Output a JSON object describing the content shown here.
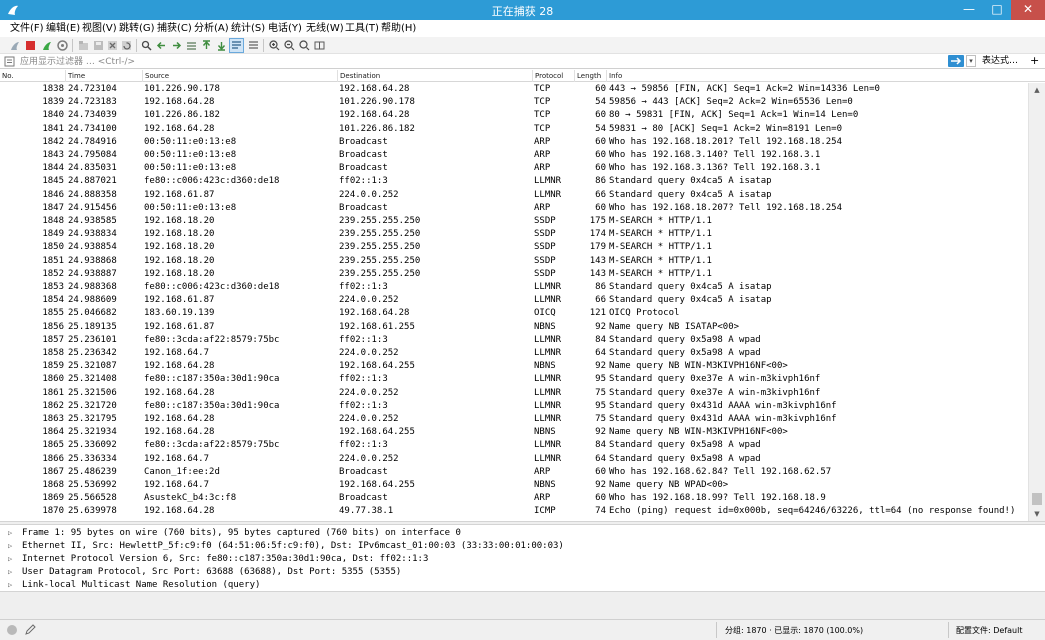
{
  "window": {
    "title": "正在捕获 28",
    "minimize": "—",
    "maximize": "□",
    "close": "✕"
  },
  "menu": [
    "文件(F)",
    "编辑(E)",
    "视图(V)",
    "跳转(G)",
    "捕获(C)",
    "分析(A)",
    "统计(S)",
    "电话(Y)",
    "无线(W)",
    "工具(T)",
    "帮助(H)"
  ],
  "filter": {
    "placeholder": "应用显示过滤器 … <Ctrl-/>",
    "dropdown_glyph": "▾",
    "expression_label": "表达式…",
    "add_label": "+"
  },
  "columns": [
    "No.",
    "Time",
    "Source",
    "Destination",
    "Protocol",
    "Length",
    "Info"
  ],
  "packets": [
    {
      "no": "1838",
      "time": "24.723104",
      "src": "101.226.90.178",
      "dst": "192.168.64.28",
      "proto": "TCP",
      "len": "60",
      "info": "443 → 59856 [FIN, ACK] Seq=1 Ack=2 Win=14336 Len=0"
    },
    {
      "no": "1839",
      "time": "24.723183",
      "src": "192.168.64.28",
      "dst": "101.226.90.178",
      "proto": "TCP",
      "len": "54",
      "info": "59856 → 443 [ACK] Seq=2 Ack=2 Win=65536 Len=0"
    },
    {
      "no": "1840",
      "time": "24.734039",
      "src": "101.226.86.182",
      "dst": "192.168.64.28",
      "proto": "TCP",
      "len": "60",
      "info": "80 → 59831 [FIN, ACK] Seq=1 Ack=1 Win=14 Len=0"
    },
    {
      "no": "1841",
      "time": "24.734100",
      "src": "192.168.64.28",
      "dst": "101.226.86.182",
      "proto": "TCP",
      "len": "54",
      "info": "59831 → 80 [ACK] Seq=1 Ack=2 Win=8191 Len=0"
    },
    {
      "no": "1842",
      "time": "24.784916",
      "src": "00:50:11:e0:13:e8",
      "dst": "Broadcast",
      "proto": "ARP",
      "len": "60",
      "info": "Who has 192.168.18.201? Tell 192.168.18.254"
    },
    {
      "no": "1843",
      "time": "24.795084",
      "src": "00:50:11:e0:13:e8",
      "dst": "Broadcast",
      "proto": "ARP",
      "len": "60",
      "info": "Who has 192.168.3.140? Tell 192.168.3.1"
    },
    {
      "no": "1844",
      "time": "24.835031",
      "src": "00:50:11:e0:13:e8",
      "dst": "Broadcast",
      "proto": "ARP",
      "len": "60",
      "info": "Who has 192.168.3.136? Tell 192.168.3.1"
    },
    {
      "no": "1845",
      "time": "24.887021",
      "src": "fe80::c006:423c:d360:de18",
      "dst": "ff02::1:3",
      "proto": "LLMNR",
      "len": "86",
      "info": "Standard query 0x4ca5 A isatap"
    },
    {
      "no": "1846",
      "time": "24.888358",
      "src": "192.168.61.87",
      "dst": "224.0.0.252",
      "proto": "LLMNR",
      "len": "66",
      "info": "Standard query 0x4ca5 A isatap"
    },
    {
      "no": "1847",
      "time": "24.915456",
      "src": "00:50:11:e0:13:e8",
      "dst": "Broadcast",
      "proto": "ARP",
      "len": "60",
      "info": "Who has 192.168.18.207? Tell 192.168.18.254"
    },
    {
      "no": "1848",
      "time": "24.938585",
      "src": "192.168.18.20",
      "dst": "239.255.255.250",
      "proto": "SSDP",
      "len": "175",
      "info": "M-SEARCH * HTTP/1.1"
    },
    {
      "no": "1849",
      "time": "24.938834",
      "src": "192.168.18.20",
      "dst": "239.255.255.250",
      "proto": "SSDP",
      "len": "174",
      "info": "M-SEARCH * HTTP/1.1"
    },
    {
      "no": "1850",
      "time": "24.938854",
      "src": "192.168.18.20",
      "dst": "239.255.255.250",
      "proto": "SSDP",
      "len": "179",
      "info": "M-SEARCH * HTTP/1.1"
    },
    {
      "no": "1851",
      "time": "24.938868",
      "src": "192.168.18.20",
      "dst": "239.255.255.250",
      "proto": "SSDP",
      "len": "143",
      "info": "M-SEARCH * HTTP/1.1"
    },
    {
      "no": "1852",
      "time": "24.938887",
      "src": "192.168.18.20",
      "dst": "239.255.255.250",
      "proto": "SSDP",
      "len": "143",
      "info": "M-SEARCH * HTTP/1.1"
    },
    {
      "no": "1853",
      "time": "24.988368",
      "src": "fe80::c006:423c:d360:de18",
      "dst": "ff02::1:3",
      "proto": "LLMNR",
      "len": "86",
      "info": "Standard query 0x4ca5 A isatap"
    },
    {
      "no": "1854",
      "time": "24.988609",
      "src": "192.168.61.87",
      "dst": "224.0.0.252",
      "proto": "LLMNR",
      "len": "66",
      "info": "Standard query 0x4ca5 A isatap"
    },
    {
      "no": "1855",
      "time": "25.046682",
      "src": "183.60.19.139",
      "dst": "192.168.64.28",
      "proto": "OICQ",
      "len": "121",
      "info": "OICQ Protocol"
    },
    {
      "no": "1856",
      "time": "25.189135",
      "src": "192.168.61.87",
      "dst": "192.168.61.255",
      "proto": "NBNS",
      "len": "92",
      "info": "Name query NB ISATAP<00>"
    },
    {
      "no": "1857",
      "time": "25.236101",
      "src": "fe80::3cda:af22:8579:75bc",
      "dst": "ff02::1:3",
      "proto": "LLMNR",
      "len": "84",
      "info": "Standard query 0x5a98 A wpad"
    },
    {
      "no": "1858",
      "time": "25.236342",
      "src": "192.168.64.7",
      "dst": "224.0.0.252",
      "proto": "LLMNR",
      "len": "64",
      "info": "Standard query 0x5a98 A wpad"
    },
    {
      "no": "1859",
      "time": "25.321087",
      "src": "192.168.64.28",
      "dst": "192.168.64.255",
      "proto": "NBNS",
      "len": "92",
      "info": "Name query NB WIN-M3KIVPH16NF<00>"
    },
    {
      "no": "1860",
      "time": "25.321408",
      "src": "fe80::c187:350a:30d1:90ca",
      "dst": "ff02::1:3",
      "proto": "LLMNR",
      "len": "95",
      "info": "Standard query 0xe37e A win-m3kivph16nf"
    },
    {
      "no": "1861",
      "time": "25.321506",
      "src": "192.168.64.28",
      "dst": "224.0.0.252",
      "proto": "LLMNR",
      "len": "75",
      "info": "Standard query 0xe37e A win-m3kivph16nf"
    },
    {
      "no": "1862",
      "time": "25.321720",
      "src": "fe80::c187:350a:30d1:90ca",
      "dst": "ff02::1:3",
      "proto": "LLMNR",
      "len": "95",
      "info": "Standard query 0x431d AAAA win-m3kivph16nf"
    },
    {
      "no": "1863",
      "time": "25.321795",
      "src": "192.168.64.28",
      "dst": "224.0.0.252",
      "proto": "LLMNR",
      "len": "75",
      "info": "Standard query 0x431d AAAA win-m3kivph16nf"
    },
    {
      "no": "1864",
      "time": "25.321934",
      "src": "192.168.64.28",
      "dst": "192.168.64.255",
      "proto": "NBNS",
      "len": "92",
      "info": "Name query NB WIN-M3KIVPH16NF<00>"
    },
    {
      "no": "1865",
      "time": "25.336092",
      "src": "fe80::3cda:af22:8579:75bc",
      "dst": "ff02::1:3",
      "proto": "LLMNR",
      "len": "84",
      "info": "Standard query 0x5a98 A wpad"
    },
    {
      "no": "1866",
      "time": "25.336334",
      "src": "192.168.64.7",
      "dst": "224.0.0.252",
      "proto": "LLMNR",
      "len": "64",
      "info": "Standard query 0x5a98 A wpad"
    },
    {
      "no": "1867",
      "time": "25.486239",
      "src": "Canon_1f:ee:2d",
      "dst": "Broadcast",
      "proto": "ARP",
      "len": "60",
      "info": "Who has 192.168.62.84? Tell 192.168.62.57"
    },
    {
      "no": "1868",
      "time": "25.536992",
      "src": "192.168.64.7",
      "dst": "192.168.64.255",
      "proto": "NBNS",
      "len": "92",
      "info": "Name query NB WPAD<00>"
    },
    {
      "no": "1869",
      "time": "25.566528",
      "src": "AsustekC_b4:3c:f8",
      "dst": "Broadcast",
      "proto": "ARP",
      "len": "60",
      "info": "Who has 192.168.18.99? Tell 192.168.18.9"
    },
    {
      "no": "1870",
      "time": "25.639978",
      "src": "192.168.64.28",
      "dst": "49.77.38.1",
      "proto": "ICMP",
      "len": "74",
      "info": "Echo (ping) request  id=0x000b, seq=64246/63226, ttl=64 (no response found!)"
    }
  ],
  "details": [
    "Frame 1: 95 bytes on wire (760 bits), 95 bytes captured (760 bits) on interface 0",
    "Ethernet II, Src: HewlettP_5f:c9:f0 (64:51:06:5f:c9:f0), Dst: IPv6mcast_01:00:03 (33:33:00:01:00:03)",
    "Internet Protocol Version 6, Src: fe80::c187:350a:30d1:90ca, Dst: ff02::1:3",
    "User Datagram Protocol, Src Port: 63688 (63688), Dst Port: 5355 (5355)",
    "Link-local Multicast Name Resolution (query)"
  ],
  "details_expander": "▷",
  "status": {
    "packets": "分组: 1870 · 已显示: 1870 (100.0%)",
    "profile": "配置文件: Default"
  },
  "scroll": {
    "up": "▲",
    "down": "▼"
  },
  "colors": {
    "titlebar": "#2d9bd6",
    "close": "#c7504a",
    "apply": "#2f8fd2"
  }
}
